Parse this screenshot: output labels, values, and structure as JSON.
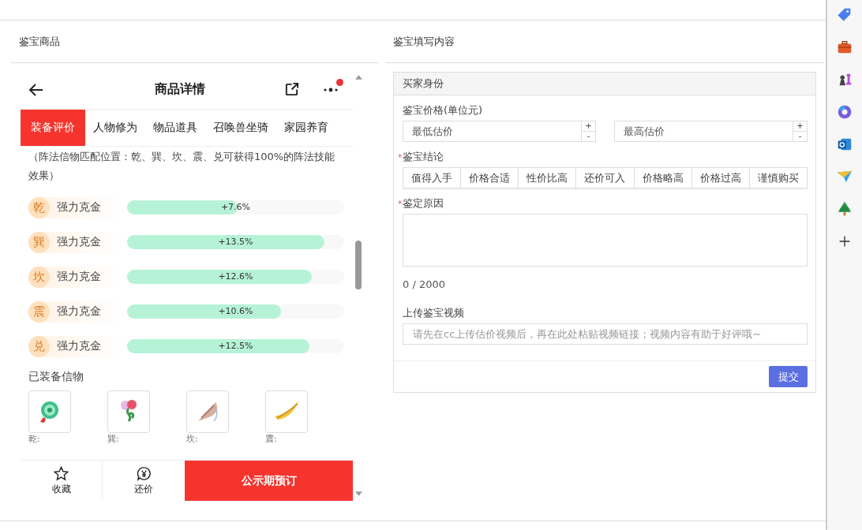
{
  "left_panel": {
    "title": "鉴宝商品"
  },
  "phone": {
    "title": "商品详情",
    "notification_dot": true,
    "tabs": [
      {
        "label": "装备评价",
        "selected": true
      },
      {
        "label": "人物修为",
        "selected": false
      },
      {
        "label": "物品道具",
        "selected": false
      },
      {
        "label": "召唤兽坐骑",
        "selected": false
      },
      {
        "label": "家园养育",
        "selected": false
      }
    ],
    "note": "（阵法信物匹配位置：乾、巽、坎、震、兑可获得100%的阵法技能效果）",
    "bonuses": [
      {
        "position": "乾",
        "name": "强力克金",
        "level": 0.51,
        "reading": "+7.6%"
      },
      {
        "position": "巽",
        "name": "强力克金",
        "level": 0.91,
        "reading": "+13.5%"
      },
      {
        "position": "坎",
        "name": "强力克金",
        "level": 0.85,
        "reading": "+12.6%"
      },
      {
        "position": "震",
        "name": "强力克金",
        "level": 0.71,
        "reading": "+10.6%"
      },
      {
        "position": "兑",
        "name": "强力克金",
        "level": 0.84,
        "reading": "+12.5%"
      }
    ],
    "equipped_title": "已装备信物",
    "equipped": [
      {
        "label": "乾:",
        "kind": "jade"
      },
      {
        "label": "巽:",
        "kind": "flower"
      },
      {
        "label": "坎:",
        "kind": "shell"
      },
      {
        "label": "震:",
        "kind": "feather"
      }
    ],
    "footer": {
      "favorite": "收藏",
      "bargain": "还价",
      "buy": "公示期预订"
    }
  },
  "right_panel": {
    "title": "鉴宝填写内容",
    "form": {
      "section": "买家身份",
      "price_label": "鉴宝价格(单位元)",
      "price_fields": [
        {
          "placeholder": "最低估价",
          "plus": "+",
          "minus": "-"
        },
        {
          "placeholder": "最高估价",
          "plus": "+",
          "minus": "-"
        }
      ],
      "conclusion_label": "鉴宝结论",
      "conclusion_required": true,
      "required_mark": "*",
      "conclusions": [
        {
          "label": "值得入手",
          "selected": false
        },
        {
          "label": "价格合适",
          "selected": false
        },
        {
          "label": "性价比高",
          "selected": false
        },
        {
          "label": "还价可入",
          "selected": false
        },
        {
          "label": "价格略高",
          "selected": false
        },
        {
          "label": "价格过高",
          "selected": false
        },
        {
          "label": "谨慎购买",
          "selected": false
        }
      ],
      "reason_label": "鉴定原因",
      "reason_required": true,
      "counter": "0 / 2000",
      "video_label": "上传鉴宝视频",
      "video_field": {
        "placeholder": "请先在cc上传估价视频后，再在此处粘贴视频链接；视频内容有助于好评哦~"
      },
      "submit": "提交"
    }
  },
  "sidebar": {
    "icons": [
      {
        "kind": "tag"
      },
      {
        "kind": "briefcase"
      },
      {
        "kind": "chess"
      },
      {
        "kind": "ring"
      },
      {
        "kind": "mail"
      },
      {
        "kind": "plane"
      },
      {
        "kind": "tree"
      },
      {
        "kind": "plus"
      }
    ]
  }
}
